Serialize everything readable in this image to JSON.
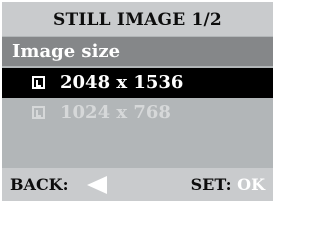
{
  "header": {
    "title": "STILL IMAGE 1/2"
  },
  "section": {
    "title": "Image size"
  },
  "options": [
    {
      "label": "2048 x 1536",
      "selected": true,
      "icon": "large-size-icon"
    },
    {
      "label": "1024 x 768",
      "selected": false,
      "icon": "small-size-icon"
    }
  ],
  "footer": {
    "back_label": "BACK:",
    "set_label": "SET:",
    "ok_label": "OK"
  },
  "colors": {
    "title_bar": "#c9cbcd",
    "section_bar": "#858789",
    "background": "#b2b6b8",
    "selected_row": "#000000",
    "text_light": "#ffffff"
  }
}
